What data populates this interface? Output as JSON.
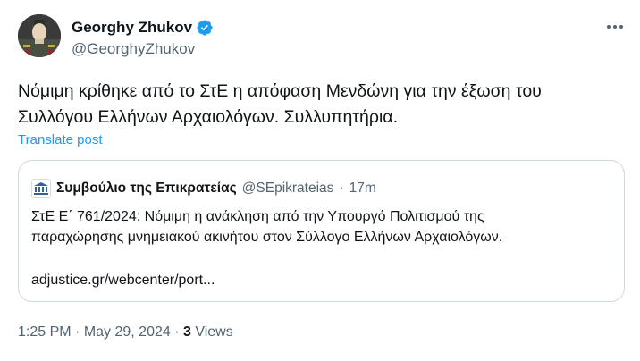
{
  "author": {
    "name": "Georghy Zhukov",
    "handle": "@GeorghyZhukov",
    "verified": true,
    "avatar_icon": "portrait-avatar-icon"
  },
  "more_icon": "more-dots-icon",
  "tweet": {
    "text_line1": "Νόμιμη κρίθηκε από το ΣτΕ η απόφαση Μενδώνη για την έξωση του",
    "text_line2": "Συλλόγου Ελλήνων Αρχαιολόγων. Συλλυπητήρια.",
    "translate_label": "Translate post"
  },
  "quote": {
    "avatar_icon": "court-building-icon",
    "name": "Συμβούλιο της Επικρατείας",
    "handle": "@SEpikrateias",
    "separator": "·",
    "time": "17m",
    "text_line1": "ΣτΕ Ε΄ 761/2024: Νόμιμη η ανάκληση από την Υπουργό Πολιτισμού της",
    "text_line2": "παραχώρησης μνημειακού ακινήτου στον Σύλλογο Ελλήνων Αρχαιολόγων.",
    "link": "adjustice.gr/webcenter/port..."
  },
  "meta": {
    "time": "1:25 PM",
    "sep1": " · ",
    "date": "May 29, 2024",
    "sep2": " · ",
    "views_count": "3",
    "views_label": " Views"
  },
  "colors": {
    "accent": "#1d9bf0",
    "text": "#0f1419",
    "secondary": "#536471",
    "border": "#cfd9de"
  }
}
